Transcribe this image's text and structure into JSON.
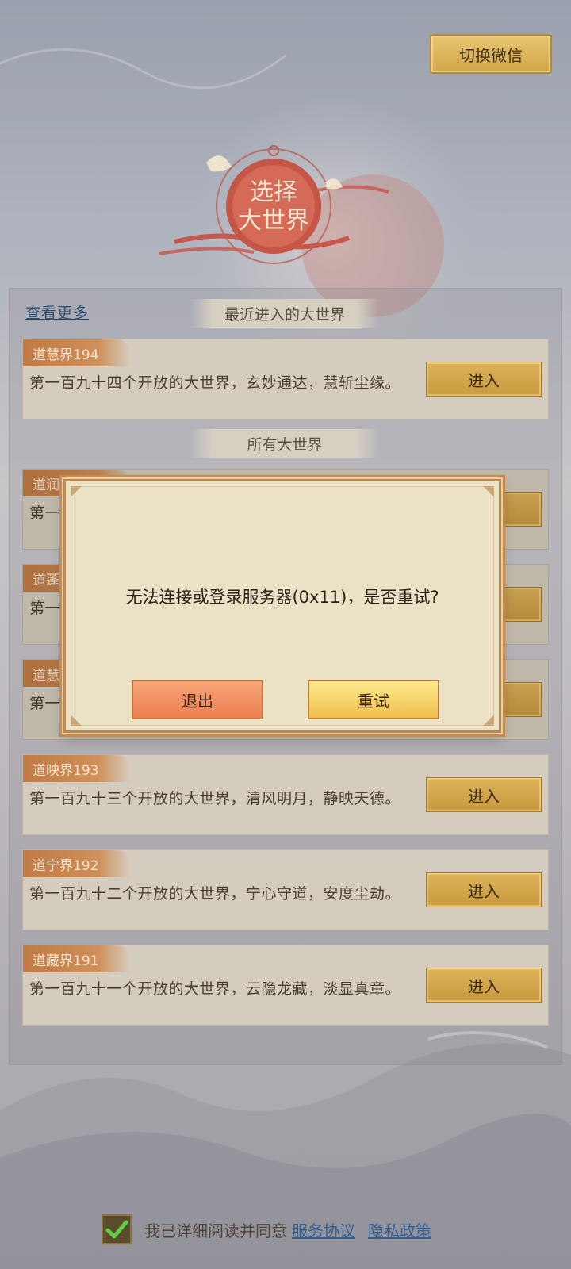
{
  "header": {
    "switch_label": "切换微信"
  },
  "emblem": {
    "title_line1": "选择",
    "title_line2": "大世界"
  },
  "panel": {
    "see_more": "查看更多",
    "recent_title": "最近进入的大世界",
    "all_title": "所有大世界"
  },
  "recent": [
    {
      "tag": "道慧界194",
      "desc": "第一百九十四个开放的大世界，玄妙通达，慧斩尘缘。",
      "enter": "进入"
    }
  ],
  "all_worlds": [
    {
      "tag": "道润",
      "desc": "第一",
      "enter": "进入",
      "partially_hidden": true
    },
    {
      "tag": "道蓬",
      "desc": "第一",
      "enter": "进入",
      "partially_hidden": true
    },
    {
      "tag": "道慧",
      "desc": "第一",
      "enter": "进入",
      "partially_hidden": true
    },
    {
      "tag": "道映界193",
      "desc": "第一百九十三个开放的大世界，清风明月，静映天德。",
      "enter": "进入"
    },
    {
      "tag": "道宁界192",
      "desc": "第一百九十二个开放的大世界，宁心守道，安度尘劫。",
      "enter": "进入"
    },
    {
      "tag": "道藏界191",
      "desc": "第一百九十一个开放的大世界，云隐龙藏，淡显真章。",
      "enter": "进入"
    }
  ],
  "dialog": {
    "message": "无法连接或登录服务器(0x11)，是否重试?",
    "exit_label": "退出",
    "retry_label": "重试"
  },
  "agreement": {
    "checked": true,
    "text": "我已详细阅读并同意",
    "service_link": "服务协议",
    "privacy_link": "隐私政策"
  },
  "colors": {
    "gold_button": "#d2a64a",
    "exit_button": "#ee7f4f",
    "retry_button": "#f1c04c",
    "card_tag": "#c07a43",
    "link": "#2f5f93"
  }
}
